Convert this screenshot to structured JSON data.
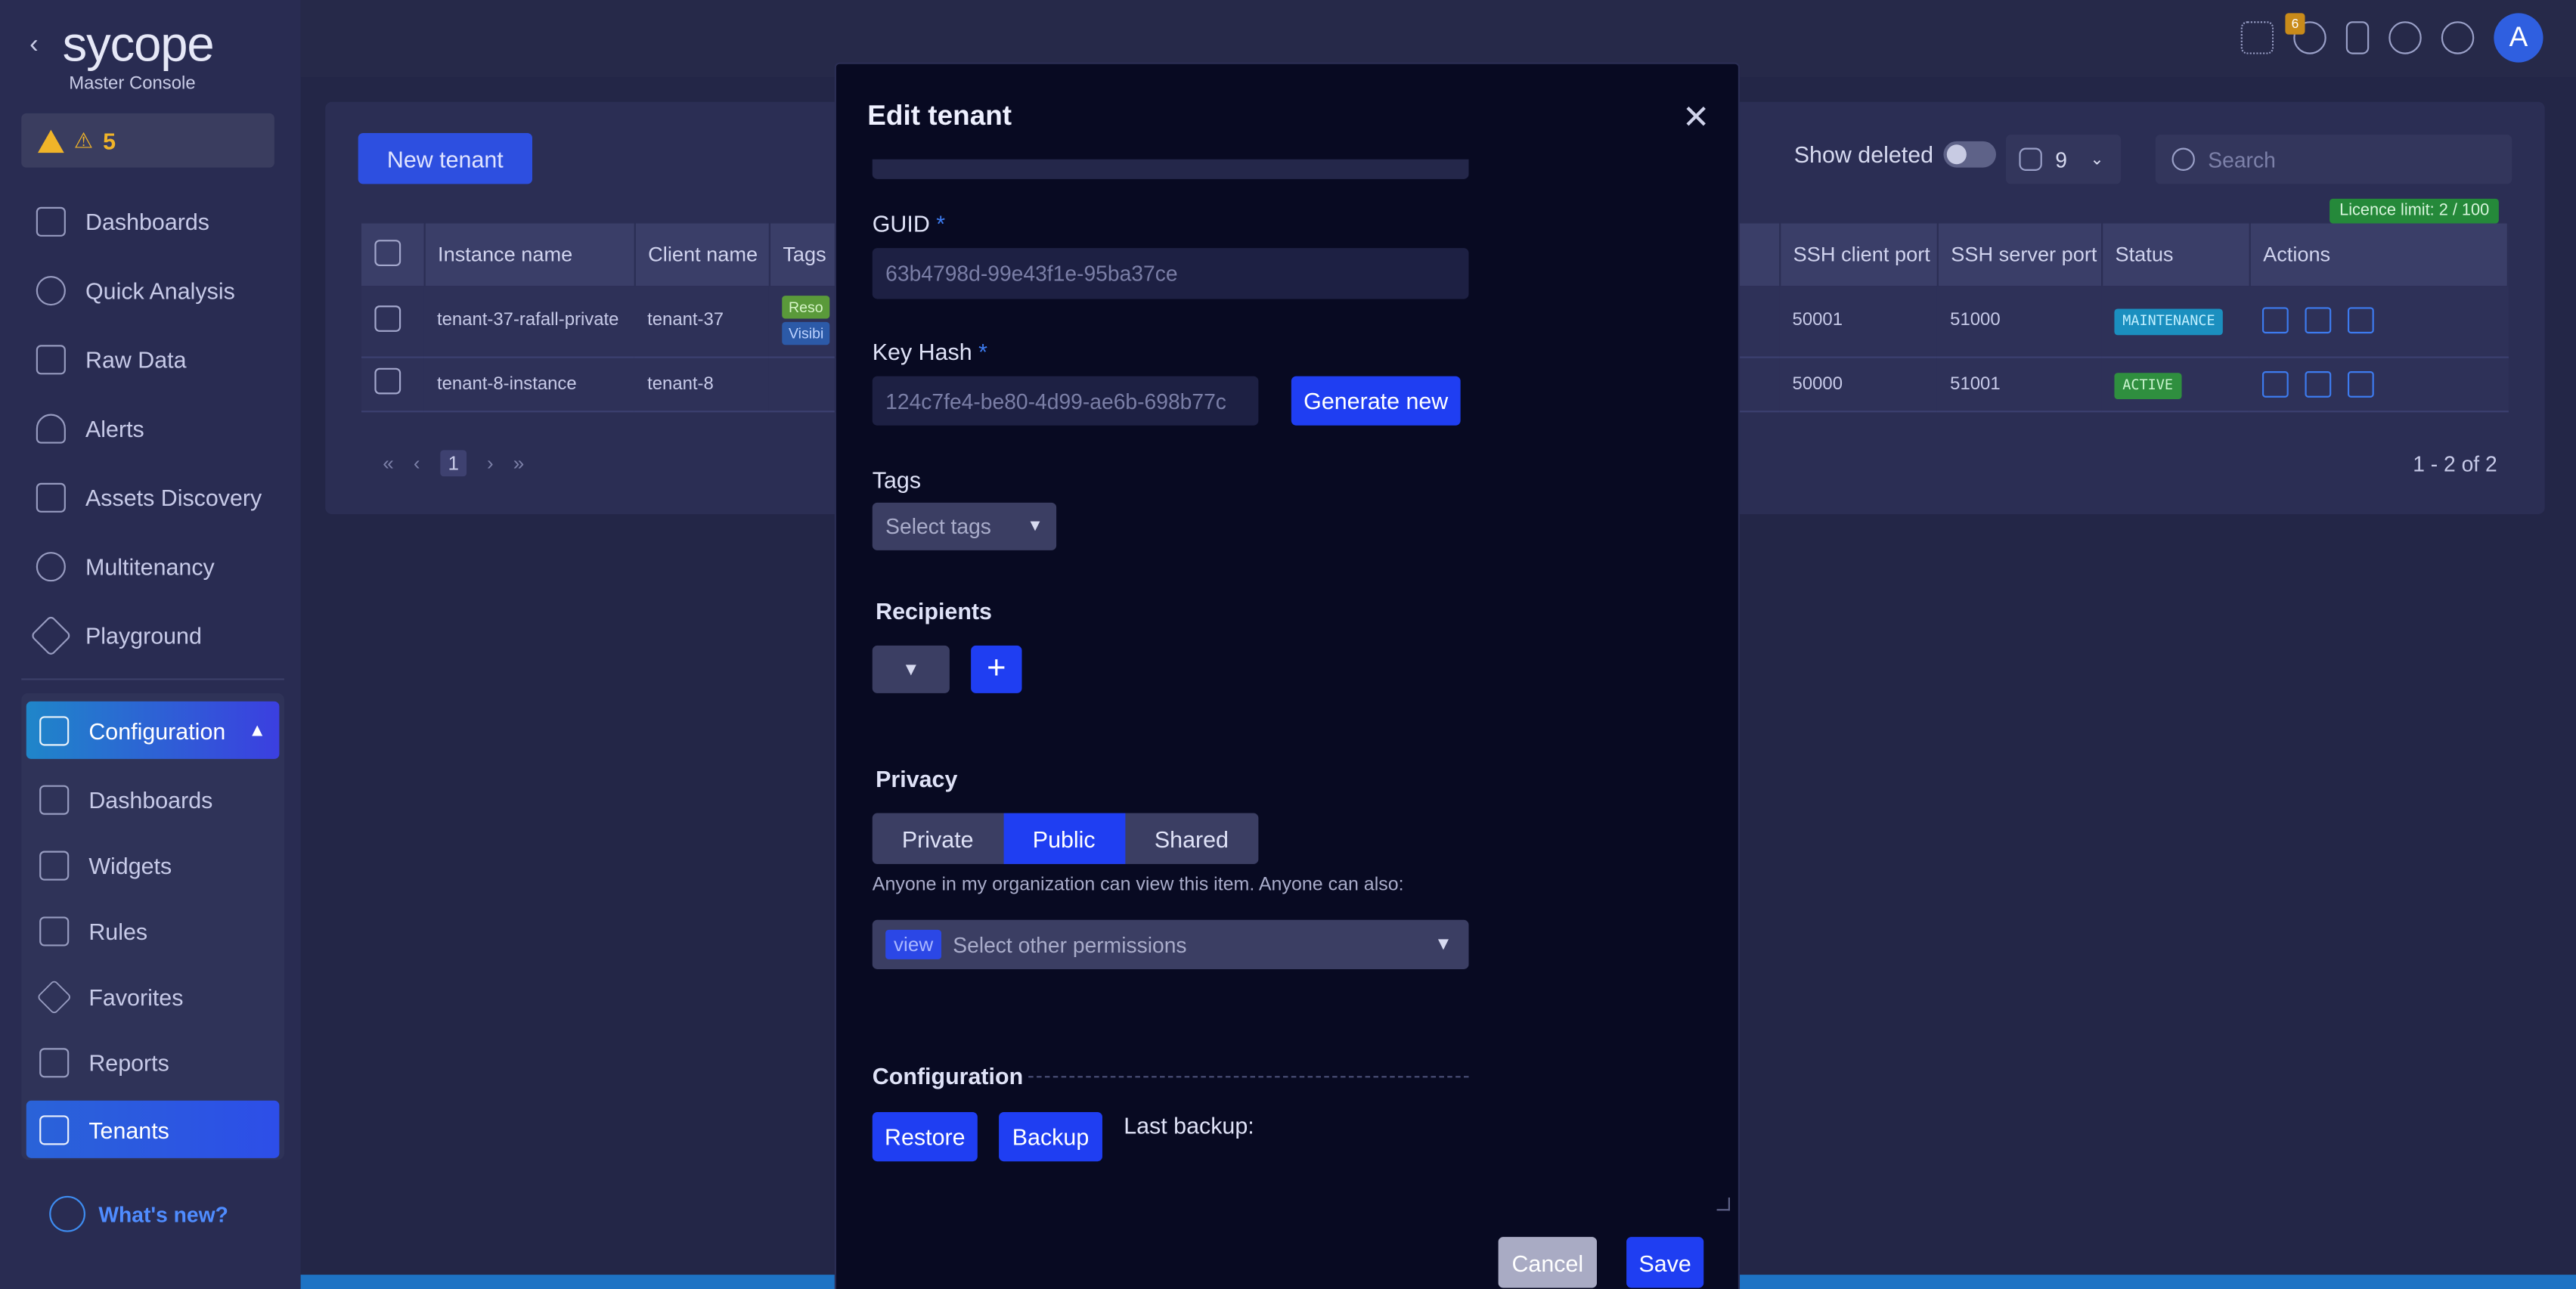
{
  "app": {
    "logo": "sycope",
    "logo_sub": "Master Console",
    "alert_count": "5",
    "notification_badge": "6",
    "avatar_letter": "A",
    "whats_new": "What's new?"
  },
  "sidebar": {
    "items": [
      {
        "label": "Dashboards",
        "icon": "dashboards-icon"
      },
      {
        "label": "Quick Analysis",
        "icon": "quick-analysis-icon"
      },
      {
        "label": "Raw Data",
        "icon": "raw-data-icon"
      },
      {
        "label": "Alerts",
        "icon": "alerts-icon"
      },
      {
        "label": "Assets Discovery",
        "icon": "assets-icon"
      },
      {
        "label": "Multitenancy",
        "icon": "multitenancy-icon"
      },
      {
        "label": "Playground",
        "icon": "playground-icon"
      }
    ],
    "configuration": {
      "label": "Configuration",
      "items": [
        {
          "label": "Dashboards"
        },
        {
          "label": "Widgets"
        },
        {
          "label": "Rules"
        },
        {
          "label": "Favorites"
        },
        {
          "label": "Reports"
        },
        {
          "label": "Tenants"
        }
      ]
    }
  },
  "toolbar": {
    "new_tenant": "New tenant",
    "show_deleted": "Show deleted",
    "columns_count": "9",
    "search_placeholder": "Search",
    "licence": "Licence limit: 2 / 100"
  },
  "table": {
    "headers": [
      "Instance name",
      "Client name",
      "Tags",
      "SSH client port",
      "SSH server port",
      "Status",
      "Actions"
    ],
    "rows": [
      {
        "instance": "tenant-37-rafall-private",
        "client": "tenant-37",
        "tag1": "Reso",
        "tag2": "Visibi",
        "ssh_client": "50001",
        "ssh_server": "51000",
        "status": "MAINTENANCE"
      },
      {
        "instance": "tenant-8-instance",
        "client": "tenant-8",
        "tag1": "",
        "tag2": "",
        "ssh_client": "50000",
        "ssh_server": "51001",
        "status": "ACTIVE"
      }
    ],
    "page": "1",
    "count": "1 - 2 of 2"
  },
  "modal": {
    "title": "Edit tenant",
    "guid_label": "GUID",
    "guid_value": "63b4798d-99e43f1e-95ba37ce",
    "keyhash_label": "Key Hash",
    "keyhash_value": "124c7fe4-be80-4d99-ae6b-698b77c",
    "generate_new": "Generate new",
    "tags_label": "Tags",
    "tags_placeholder": "Select tags",
    "recipients_label": "Recipients",
    "privacy_label": "Privacy",
    "privacy_options": [
      "Private",
      "Public",
      "Shared"
    ],
    "privacy_selected": "Public",
    "privacy_help": "Anyone in my organization can view this item. Anyone can also:",
    "permission_chip": "view",
    "permission_placeholder": "Select other permissions",
    "configuration_label": "Configuration",
    "restore": "Restore",
    "backup": "Backup",
    "last_backup": "Last backup:",
    "cancel": "Cancel",
    "save": "Save"
  }
}
